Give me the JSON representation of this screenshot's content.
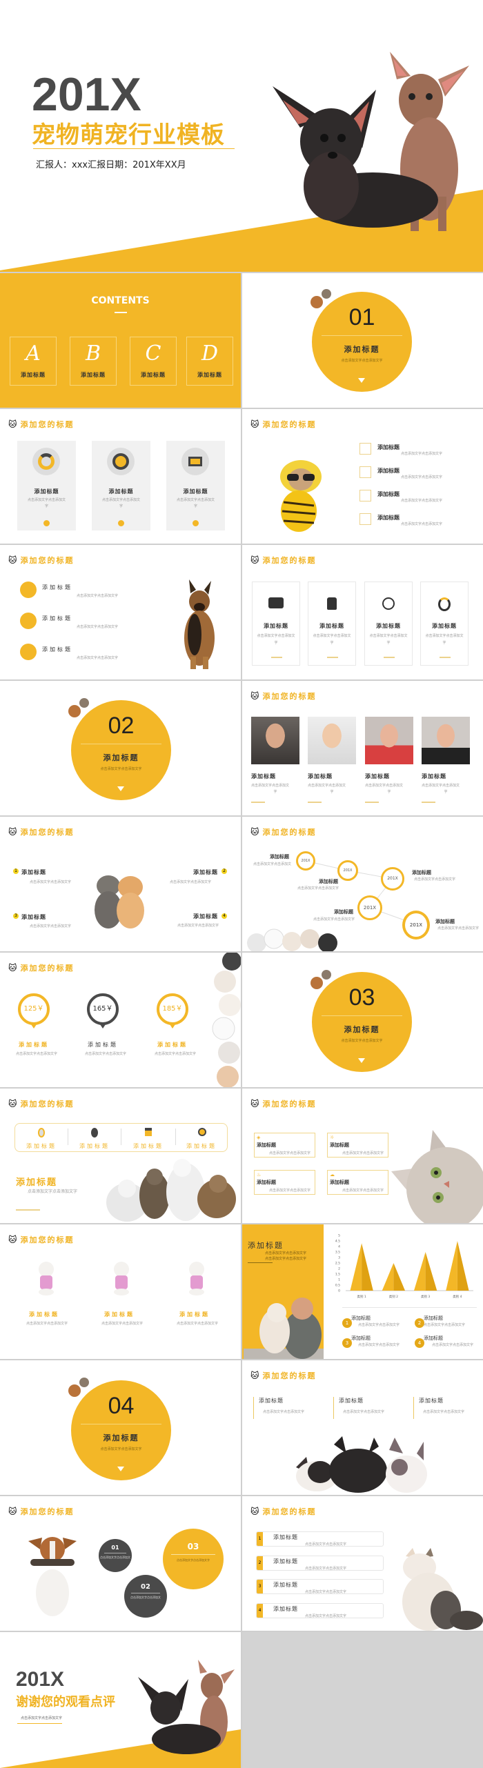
{
  "colors": {
    "accent": "#F3B727",
    "dark": "#4A4A4A",
    "text": "#333333",
    "gap": "#CFCFCF"
  },
  "cover": {
    "year": "201X",
    "title": "宠物萌宠行业模板",
    "reporter": "汇报人：xxx汇报日期：201X年XX月"
  },
  "common": {
    "header": "添加您的标题",
    "item_title": "添加标题",
    "body": "点击添加文字点击添加文字",
    "body_short": "点击添加文字点击添加文",
    "body_tail": "字"
  },
  "contents": {
    "heading": "CONTENTS",
    "items": [
      {
        "letter": "A",
        "label": "添加标题"
      },
      {
        "letter": "B",
        "label": "添加标题"
      },
      {
        "letter": "C",
        "label": "添加标题"
      },
      {
        "letter": "D",
        "label": "添加标题"
      }
    ]
  },
  "sections": [
    {
      "number": "01",
      "title": "添加标题",
      "subtitle": "点击添加文字点击添加文字"
    },
    {
      "number": "02",
      "title": "添加标题",
      "subtitle": "点击添加文字点击添加文字"
    },
    {
      "number": "03",
      "title": "添加标题",
      "subtitle": "点击添加文字点击添加文字"
    },
    {
      "number": "04",
      "title": "添加标题",
      "subtitle": "点击添加文字点击添加文字"
    }
  ],
  "timeline": {
    "years": [
      "201X",
      "201X",
      "201X",
      "201X",
      "201X"
    ]
  },
  "pricing": {
    "items": [
      {
        "price": "125￥"
      },
      {
        "price": "165￥"
      },
      {
        "price": "185￥"
      }
    ]
  },
  "numbered": {
    "items": [
      "1",
      "2",
      "3",
      "4"
    ]
  },
  "bubbles": {
    "items": [
      "01",
      "02",
      "03"
    ]
  },
  "chart_data": {
    "type": "bar",
    "categories": [
      "类别 1",
      "类别 2",
      "类别 3",
      "类别 4"
    ],
    "values": [
      4.3,
      2.5,
      3.5,
      4.5
    ],
    "ylim": [
      0,
      5
    ],
    "yticks": [
      "0",
      "0.5",
      "1",
      "1.5",
      "2",
      "2.5",
      "3",
      "3.5",
      "4",
      "4.5",
      "5"
    ],
    "grid": false,
    "style": "pyramid"
  },
  "thanks": {
    "year": "201X",
    "title": "谢谢您的观看点评",
    "subtitle": "点击添加文字点击添加文字"
  }
}
